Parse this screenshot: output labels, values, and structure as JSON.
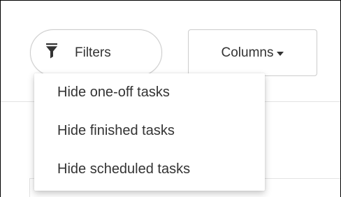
{
  "toolbar": {
    "filters_label": "Filters",
    "columns_label": "Columns"
  },
  "filters_menu": {
    "items": [
      {
        "label": "Hide one-off tasks"
      },
      {
        "label": "Hide finished tasks"
      },
      {
        "label": "Hide scheduled tasks"
      }
    ]
  },
  "icons": {
    "filters": "filter-icon",
    "columns": "caret-down-icon"
  },
  "colors": {
    "text": "#333333",
    "button_border": "#cccccc",
    "background": "#ffffff"
  }
}
